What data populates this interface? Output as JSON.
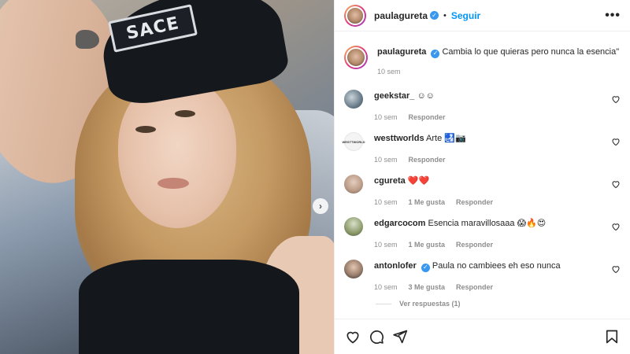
{
  "post_image": {
    "beanie_text": "SACE",
    "next_icon": "chevron-right-icon"
  },
  "header": {
    "username": "paulagureta",
    "verified_glyph": "✓",
    "separator": "•",
    "follow_label": "Seguir",
    "more_glyph": "•••"
  },
  "caption": {
    "username": "paulagureta",
    "text": "Cambia lo que quieras pero nunca la esencia\"",
    "time": "10 sem"
  },
  "comments": [
    {
      "username": "geekstar_",
      "text": "☺☺",
      "time": "10 sem",
      "likes": "",
      "reply": "Responder",
      "avatar_color": "#5b6f7d"
    },
    {
      "username": "westtworlds",
      "text": "Arte 🛃📷",
      "time": "10 sem",
      "likes": "",
      "reply": "Responder",
      "avatar_color": "#f2f2f2"
    },
    {
      "username": "cgureta",
      "text": "❤️❤️",
      "time": "10 sem",
      "likes": "1 Me gusta",
      "reply": "Responder",
      "avatar_color": "#b89a86"
    },
    {
      "username": "edgarcocom",
      "text": "Esencia maravillosaaa 😱🔥😍",
      "time": "10 sem",
      "likes": "1 Me gusta",
      "reply": "Responder",
      "avatar_color": "#8c9a6a"
    },
    {
      "username": "antonlofer",
      "text": "Paula no cambiees eh eso nunca",
      "time": "10 sem",
      "likes": "3 Me gusta",
      "reply": "Responder",
      "avatar_color": "#9b7f6d"
    }
  ],
  "replies_label": "Ver respuestas (1)",
  "actions": {
    "like_icon": "heart-icon",
    "comment_icon": "comment-icon",
    "share_icon": "send-icon",
    "save_icon": "bookmark-icon"
  },
  "colors": {
    "accent": "#0095f6",
    "verified": "#3897f0",
    "meta": "#8e8e8e",
    "text": "#262626"
  }
}
